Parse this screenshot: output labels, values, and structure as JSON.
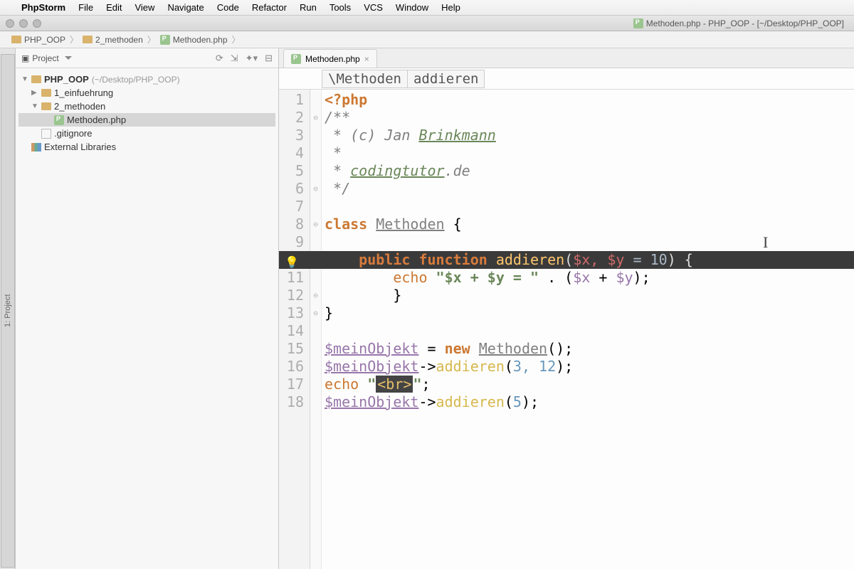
{
  "menubar": {
    "appname": "PhpStorm",
    "items": [
      "File",
      "Edit",
      "View",
      "Navigate",
      "Code",
      "Refactor",
      "Run",
      "Tools",
      "VCS",
      "Window",
      "Help"
    ]
  },
  "window_title": "Methoden.php - PHP_OOP - [~/Desktop/PHP_OOP]",
  "breadcrumbs": [
    {
      "icon": "folder",
      "label": "PHP_OOP"
    },
    {
      "icon": "folder",
      "label": "2_methoden"
    },
    {
      "icon": "php",
      "label": "Methoden.php"
    }
  ],
  "sidebar": {
    "title": "Project",
    "root": {
      "name": "PHP_OOP",
      "path": "(~/Desktop/PHP_OOP)"
    },
    "items": [
      {
        "name": "1_einfuehrung",
        "type": "folder",
        "expanded": false,
        "indent": 1
      },
      {
        "name": "2_methoden",
        "type": "folder",
        "expanded": true,
        "indent": 1
      },
      {
        "name": "Methoden.php",
        "type": "php",
        "indent": 2,
        "selected": true
      },
      {
        "name": ".gitignore",
        "type": "file",
        "indent": 1
      },
      {
        "name": "External Libraries",
        "type": "lib",
        "indent": 0
      }
    ]
  },
  "editor": {
    "tab": "Methoden.php",
    "breadcrumb": [
      "\\Methoden",
      "addieren"
    ],
    "lines": [
      {
        "n": 1,
        "t": "php_open"
      },
      {
        "n": 2,
        "t": "cmt",
        "text": "/**"
      },
      {
        "n": 3,
        "t": "cmt_auth",
        "pre": " * (c) Jan ",
        "name": "Brinkmann"
      },
      {
        "n": 4,
        "t": "cmt",
        "text": " *"
      },
      {
        "n": 5,
        "t": "cmt_link",
        "pre": " * ",
        "link": "codingtutor",
        "suf": ".de"
      },
      {
        "n": 6,
        "t": "cmt",
        "text": " */"
      },
      {
        "n": 7,
        "t": "blank"
      },
      {
        "n": 8,
        "t": "class_decl",
        "kw": "class",
        "name": "Methoden"
      },
      {
        "n": 9,
        "t": "blank"
      },
      {
        "n": 10,
        "t": "fn_decl",
        "vis": "public",
        "kw": "function",
        "name": "addieren",
        "params": "$x, $y",
        "def": " = 10",
        "hl": true
      },
      {
        "n": 11,
        "t": "echo_expr"
      },
      {
        "n": 12,
        "t": "close_brace",
        "indent": "        "
      },
      {
        "n": 13,
        "t": "close_brace",
        "indent": ""
      },
      {
        "n": 14,
        "t": "blank"
      },
      {
        "n": 15,
        "t": "new_obj",
        "var": "$meinObjekt",
        "cls": "Methoden"
      },
      {
        "n": 16,
        "t": "call",
        "var": "$meinObjekt",
        "fn": "addieren",
        "args": "3, 12"
      },
      {
        "n": 17,
        "t": "echo_br"
      },
      {
        "n": 18,
        "t": "call",
        "var": "$meinObjekt",
        "fn": "addieren",
        "args": "5"
      }
    ]
  }
}
